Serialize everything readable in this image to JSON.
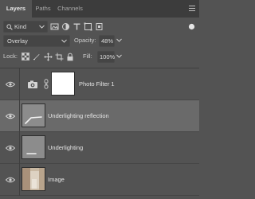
{
  "tabs": [
    {
      "label": "Layers",
      "active": true
    },
    {
      "label": "Paths",
      "active": false
    },
    {
      "label": "Channels",
      "active": false
    }
  ],
  "filter": {
    "kind_label": "Kind"
  },
  "blend": {
    "mode": "Overlay",
    "opacity_label": "Opacity:",
    "opacity_value": "48%"
  },
  "lock": {
    "label": "Lock:",
    "fill_label": "Fill:",
    "fill_value": "100%"
  },
  "layers": [
    {
      "name": "Photo Filter 1",
      "type": "adjustment",
      "visible": true,
      "selected": false
    },
    {
      "name": "Underlighting reflection",
      "type": "pixel",
      "visible": true,
      "selected": true
    },
    {
      "name": "Underlighting",
      "type": "pixel",
      "visible": true,
      "selected": false
    },
    {
      "name": "Image",
      "type": "image",
      "visible": true,
      "selected": false
    }
  ],
  "colors": {
    "panel": "#535353",
    "tabbar": "#3c3c3c",
    "selected_row": "#6a6a6a",
    "text": "#dcdcdc"
  }
}
